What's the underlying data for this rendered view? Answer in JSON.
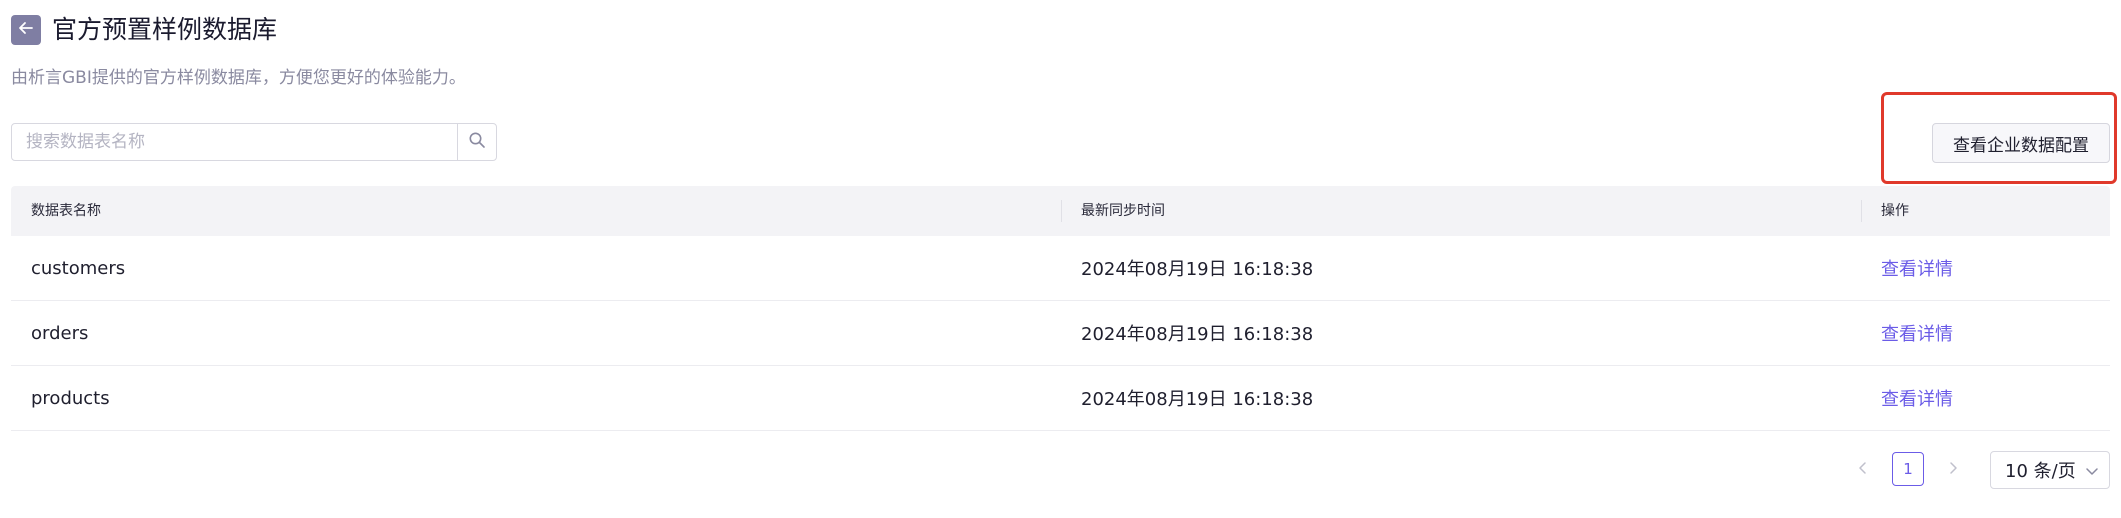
{
  "header": {
    "title": "官方预置样例数据库",
    "subtitle": "由析言GBI提供的官方样例数据库，方便您更好的体验能力。"
  },
  "search": {
    "placeholder": "搜索数据表名称",
    "value": ""
  },
  "actions": {
    "enterprise_config_label": "查看企业数据配置"
  },
  "table": {
    "columns": [
      "数据表名称",
      "最新同步时间",
      "操作"
    ],
    "rows": [
      {
        "name": "customers",
        "sync_time": "2024年08月19日 16:18:38",
        "action": "查看详情"
      },
      {
        "name": "orders",
        "sync_time": "2024年08月19日 16:18:38",
        "action": "查看详情"
      },
      {
        "name": "products",
        "sync_time": "2024年08月19日 16:18:38",
        "action": "查看详情"
      }
    ]
  },
  "pagination": {
    "current_page": "1",
    "page_size_label": "10 条/页"
  },
  "icons": {
    "back": "arrow-left-icon",
    "search": "search-icon",
    "prev": "chevron-left-icon",
    "next": "chevron-right-icon",
    "dropdown": "chevron-down-icon"
  },
  "colors": {
    "accent": "#6b5ce7",
    "back_button": "#7f7ea3",
    "highlight": "#e0392b",
    "header_bg": "#f3f3f6"
  }
}
